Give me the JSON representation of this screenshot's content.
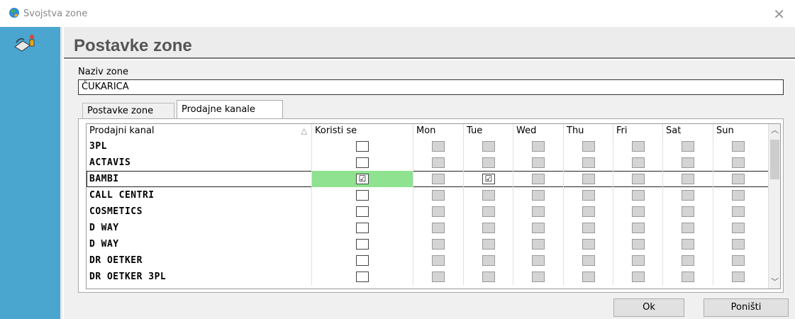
{
  "window": {
    "title": "Svojstva zone"
  },
  "header": {
    "title": "Postavke zone"
  },
  "form": {
    "name_label": "Naziv zone",
    "name_value": "ČUKARICA"
  },
  "tabs": [
    {
      "label": "Postavke zone",
      "active": false
    },
    {
      "label": "Prodajne kanale",
      "active": true
    }
  ],
  "grid": {
    "columns": [
      "Prodajni kanal",
      "Koristi se",
      "Mon",
      "Tue",
      "Wed",
      "Thu",
      "Fri",
      "Sat",
      "Sun"
    ],
    "sort_indicator": "△",
    "rows": [
      {
        "name": "3PL",
        "used": false,
        "days": [
          false,
          false,
          false,
          false,
          false,
          false,
          false
        ]
      },
      {
        "name": "ACTAVIS",
        "used": false,
        "days": [
          false,
          false,
          false,
          false,
          false,
          false,
          false
        ]
      },
      {
        "name": "BAMBI",
        "used": true,
        "selected": true,
        "days": [
          false,
          true,
          false,
          false,
          false,
          false,
          false
        ]
      },
      {
        "name": "CALL CENTRI",
        "used": false,
        "days": [
          false,
          false,
          false,
          false,
          false,
          false,
          false
        ]
      },
      {
        "name": "COSMETICS",
        "used": false,
        "days": [
          false,
          false,
          false,
          false,
          false,
          false,
          false
        ]
      },
      {
        "name": "D WAY",
        "used": false,
        "days": [
          false,
          false,
          false,
          false,
          false,
          false,
          false
        ]
      },
      {
        "name": "D WAY",
        "used": false,
        "days": [
          false,
          false,
          false,
          false,
          false,
          false,
          false
        ]
      },
      {
        "name": "DR OETKER",
        "used": false,
        "days": [
          false,
          false,
          false,
          false,
          false,
          false,
          false
        ]
      },
      {
        "name": "DR OETKER 3PL",
        "used": false,
        "days": [
          false,
          false,
          false,
          false,
          false,
          false,
          false
        ]
      }
    ],
    "check_glyph": "☑"
  },
  "buttons": {
    "ok": "Ok",
    "cancel": "Poništi"
  },
  "colors": {
    "sidebar": "#4aa5cf",
    "used_cell": "#8fe28f",
    "header_bg": "#ececec"
  },
  "icons": {
    "title": "app-globe-icon",
    "sidebar": "zone-settings-icon",
    "close": "close-icon"
  }
}
